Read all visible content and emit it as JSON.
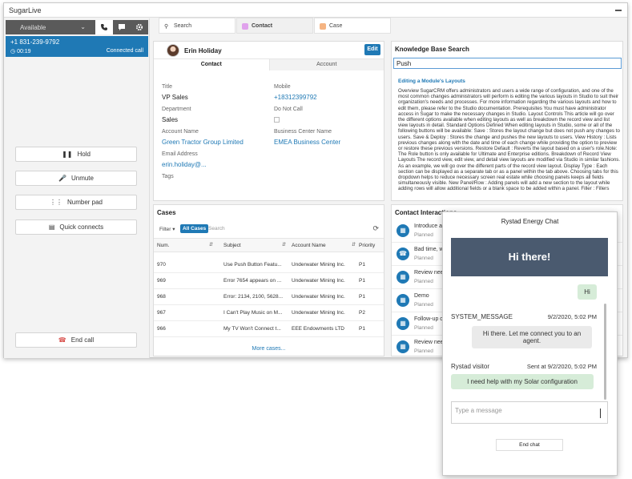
{
  "app": {
    "title": "SugarLive"
  },
  "phone": {
    "status": "Available",
    "number": "+1 831-239-9792",
    "duration": "00:19",
    "call_status": "Connected call",
    "buttons": {
      "hold": "Hold",
      "unmute": "Unmute",
      "number_pad": "Number pad",
      "quick_connects": "Quick connects",
      "end_call": "End call"
    }
  },
  "tabs": [
    {
      "label": "Search"
    },
    {
      "label": "Contact",
      "badge": "Co"
    },
    {
      "label": "Case",
      "badge": "Ca"
    }
  ],
  "contact": {
    "name": "Erin Holiday",
    "edit_label": "Edit",
    "subtabs": [
      "Contact",
      "Account"
    ],
    "fields": {
      "title_label": "Title",
      "title": "VP Sales",
      "mobile_label": "Mobile",
      "mobile": "+18312399792",
      "department_label": "Department",
      "department": "Sales",
      "dnc_label": "Do Not Call",
      "account_label": "Account Name",
      "account": "Green Tractor Group Limited",
      "bcn_label": "Business Center Name",
      "bcn": "EMEA Business Center",
      "email_label": "Email Address",
      "email": "erin.holiday@...",
      "tags_label": "Tags"
    }
  },
  "kb": {
    "title": "Knowledge Base Search",
    "query": "Push",
    "article_title": "Editing a Module's Layouts",
    "article_body": "Overview SugarCRM offers administrators and users a wide range of configuration, and one of the most common changes administrators will perform is editing the various layouts in Studio to suit their organization's needs and processes. For more information regarding the various layouts and how to edit them, please refer to the Studio documentation. Prerequisites You must have administrator access in Sugar to make the necessary changes in Studio. Layout Controls This article will go over the different options available when editing layouts as well as breakdown the record view and list view layouts in detail. Standard Options Defined When editing layouts in Studio, some or all of the following buttons will be available: Save : Stores the layout change but does not push any changes to users. Save & Deploy : Stores the change and pushes the new layouts to users. View History : Lists previous changes along with the date and time of each change while providing the option to preview or restore these previous versions. Restore Default : Reverts the layout based on a user's role.Note: The Role button is only available for Ultimate and Enterprise editions. Breakdown of Record View Layouts The record view, edit view, and detail view layouts are modified via Studio in similar fashions. As an example, we will go over the different parts of the record view layout. Display Type : Each section can be displayed as a separate tab or as a panel within the tab above. Choosing tabs for this dropdown helps to reduce necessary screen real estate while choosing panels keeps all fields simultaneously visible. New Panel/Row : Adding panels will add a new section to the layout while adding rows will allow additional fields or a blank space to be added within a panel. Filler : Fillers"
  },
  "cases": {
    "title": "Cases",
    "filter_label": "Filter",
    "all_cases": "All Cases",
    "search_placeholder": "Search",
    "columns": [
      "Num.",
      "Subject",
      "Account Name",
      "Priority"
    ],
    "rows": [
      [
        "970",
        "Use Push Button Featu...",
        "Underwater Mining Inc.",
        "P1"
      ],
      [
        "969",
        "Error 7654 appears on ...",
        "Underwater Mining Inc.",
        "P1"
      ],
      [
        "968",
        "Error: 2134, 2100, 5628...",
        "Underwater Mining Inc.",
        "P1"
      ],
      [
        "967",
        "I Can't Play Music on M...",
        "Underwater Mining Inc.",
        "P2"
      ],
      [
        "966",
        "My TV Won't Connect t...",
        "EEE Endowments LTD",
        "P1"
      ]
    ],
    "more": "More cases..."
  },
  "interactions": {
    "title": "Contact Interactions",
    "items": [
      {
        "title": "Introduce a...",
        "status": "Planned"
      },
      {
        "title": "Bad time, w...",
        "status": "Planned"
      },
      {
        "title": "Review nee...",
        "status": "Planned"
      },
      {
        "title": "Demo",
        "status": "Planned"
      },
      {
        "title": "Follow-up o...",
        "status": "Planned"
      },
      {
        "title": "Review nee...",
        "status": "Planned"
      }
    ]
  },
  "chat": {
    "title": "Rystad Energy Chat",
    "greeting": "Hi there!",
    "messages": {
      "hi": "Hi",
      "system_sender": "SYSTEM_MESSAGE",
      "system_time": "9/2/2020, 5:02 PM",
      "system_text": "Hi there. Let me connect you to an agent.",
      "visitor_sender": "Rystad visitor",
      "visitor_time": "Sent at 9/2/2020, 5:02 PM",
      "visitor_text": "I need help with my Solar configuration"
    },
    "input_placeholder": "Type a message",
    "end_chat": "End chat"
  }
}
